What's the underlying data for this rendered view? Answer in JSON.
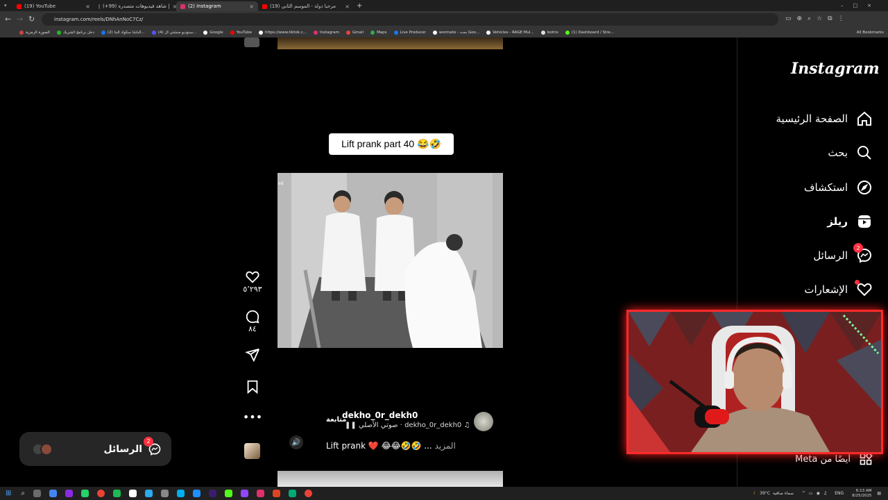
{
  "browser": {
    "tabs": [
      {
        "label": "(19) YouTube",
        "color": "#ff0000"
      },
      {
        "label": "(+99) شاهد فيديوهات متصدرة |",
        "color": "#111111"
      },
      {
        "label": "(2) Instagram",
        "color": "#e1306c",
        "active": true
      },
      {
        "label": "(19) مرحبا دولة - الموسم الثاني",
        "color": "#ff0000"
      }
    ],
    "url": "instagram.com/reels/DNhAnNoC7Cz/",
    "bookmarks": [
      "الصورة الرمزية",
      "دخل برنامج الشريك",
      "(2) الباشا سكواد البنا...",
      "(4) ستوديو منشئي ال...",
      "Google",
      "YouTube",
      "https://www.tiktok.c...",
      "Instagram",
      "Gmail",
      "Maps",
      "Live Producer",
      "wormate - بحث Goo...",
      "Vehicles - RAGE Mul...",
      "botrix",
      "(1) Dashboard / Stre..."
    ],
    "all_bookmarks": "All Bookmarks"
  },
  "sidebar": {
    "logo": "Instagram",
    "items": [
      {
        "label": "الصفحة الرئيسية",
        "icon": "home-icon"
      },
      {
        "label": "بحث",
        "icon": "search-icon"
      },
      {
        "label": "استكشاف",
        "icon": "explore-icon"
      },
      {
        "label": "ريلز",
        "icon": "reels-icon"
      },
      {
        "label": "الرسائل",
        "icon": "messenger-icon",
        "badge": "2"
      },
      {
        "label": "الإشعارات",
        "icon": "heart-icon"
      }
    ],
    "meta": "أيضًا من Meta"
  },
  "reel": {
    "caption_overlay": "Lift prank part 40 😂🤣",
    "overlay_fragment": "ed",
    "likes": "٥٬٢٩٣",
    "comments": "٨٤",
    "username": "dekho_0r_dekh0",
    "follow": "متابعة",
    "audio": "dekho_0r_dekh0 · صوتي الأصلي",
    "description": "Lift prank ❤️ 😂😂🤣🤣 ...",
    "more": "المزيد"
  },
  "messages_pill": {
    "label": "الرسائل",
    "badge": "2"
  },
  "taskbar": {
    "weather": "39°C",
    "weather_text": "سماء صافية",
    "lang": "ENG",
    "time": "6:13 AM",
    "date": "8/25/2025"
  }
}
